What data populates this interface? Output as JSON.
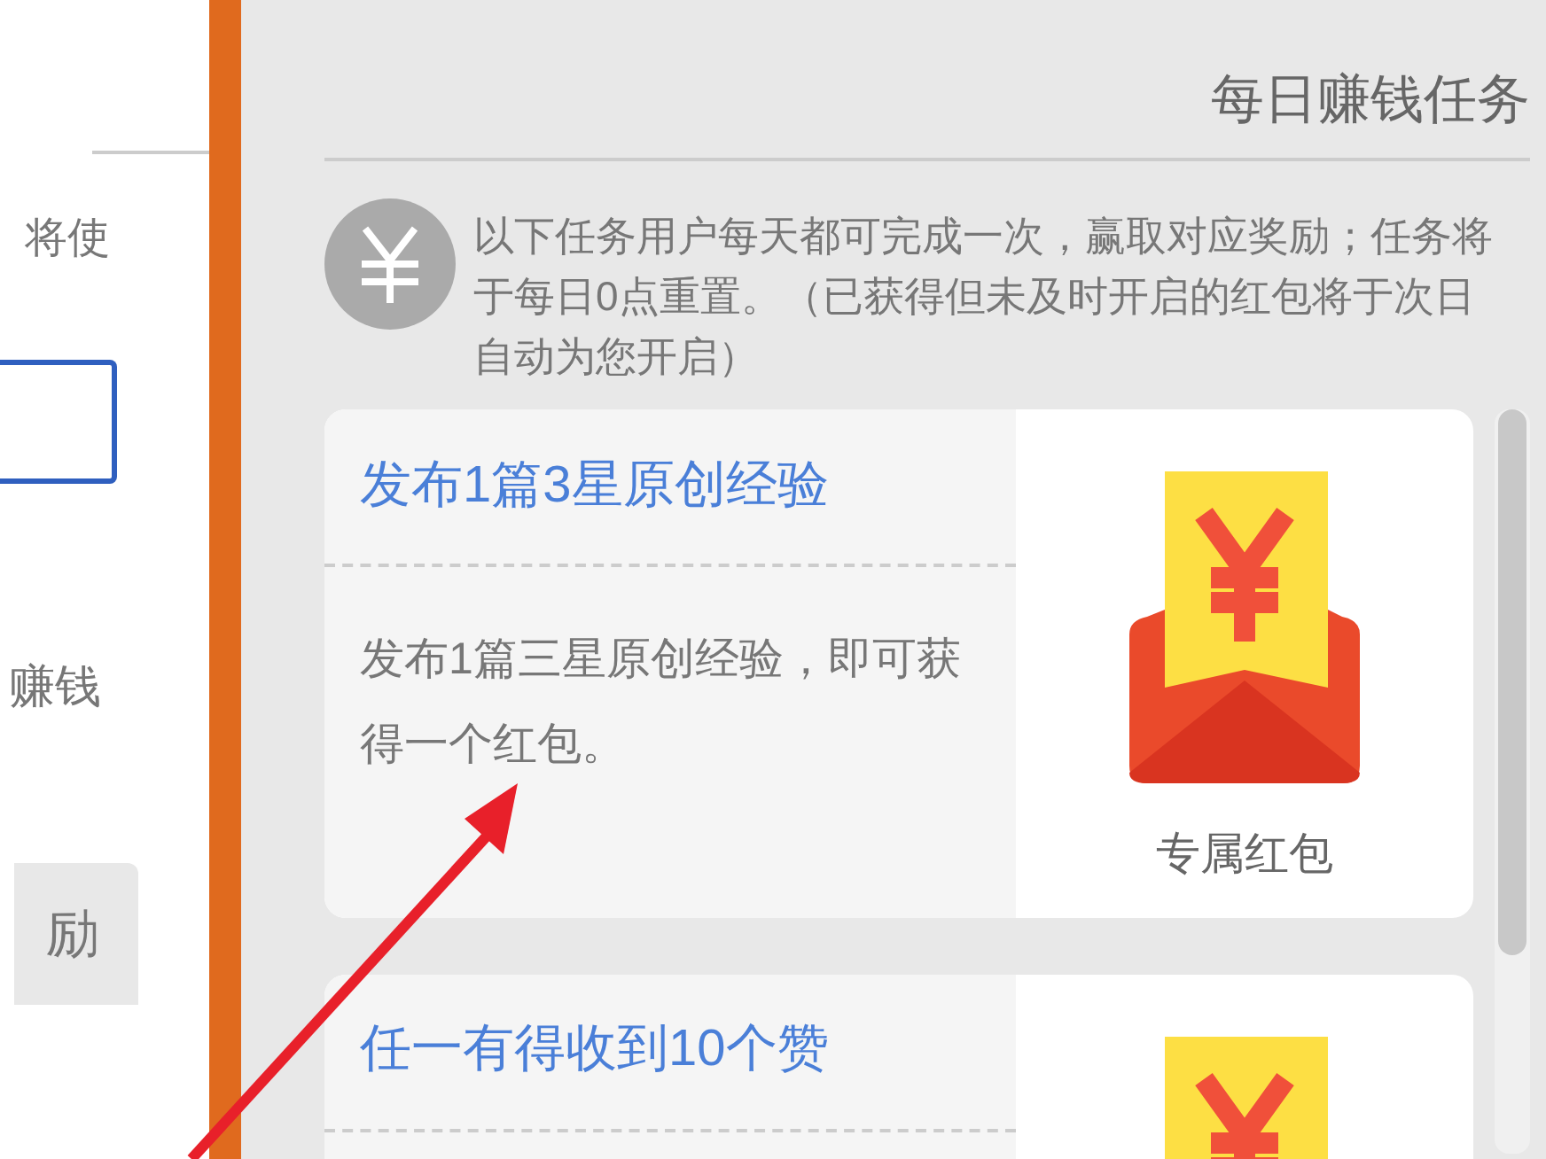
{
  "left_panel": {
    "text_1": "将使",
    "text_2": "赚钱",
    "tab": "励"
  },
  "header": {
    "title": "每日赚钱任务"
  },
  "notice": {
    "text": "以下任务用户每天都可完成一次，赢取对应奖励；任务将于每日0点重置。（已获得但未及时开启的红包将于次日自动为您开启）"
  },
  "tasks": [
    {
      "title": "发布1篇3星原创经验",
      "description": "发布1篇三星原创经验，即可获得一个红包。",
      "reward": "专属红包"
    },
    {
      "title": "任一有得收到10个赞"
    }
  ]
}
